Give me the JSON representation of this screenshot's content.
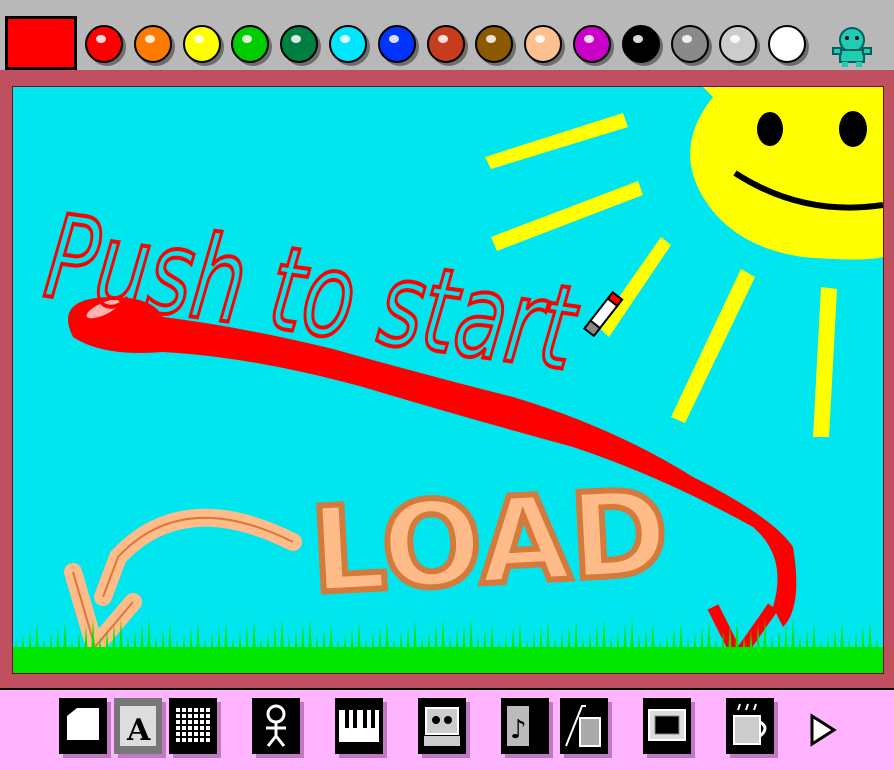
{
  "palette": {
    "current_color": "#ff0000",
    "colors": [
      "#ff0000",
      "#ff7a00",
      "#ffff00",
      "#00cc00",
      "#008040",
      "#00e6ff",
      "#0033ff",
      "#c83c1e",
      "#8b5a00",
      "#ffc090",
      "#c800c8",
      "#000000",
      "#8a8a8a",
      "#cccccc",
      "#ffffff"
    ]
  },
  "canvas": {
    "text": "Push to start",
    "load_label": "LOAD"
  },
  "toolbar": {
    "tools": [
      "new-page-tool",
      "text-tool",
      "grid-tool",
      "character-tool",
      "piano-tool",
      "robot-tool",
      "music-tool",
      "eraser-tool",
      "monitor-tool",
      "coffee-tool",
      "next-arrow"
    ]
  }
}
